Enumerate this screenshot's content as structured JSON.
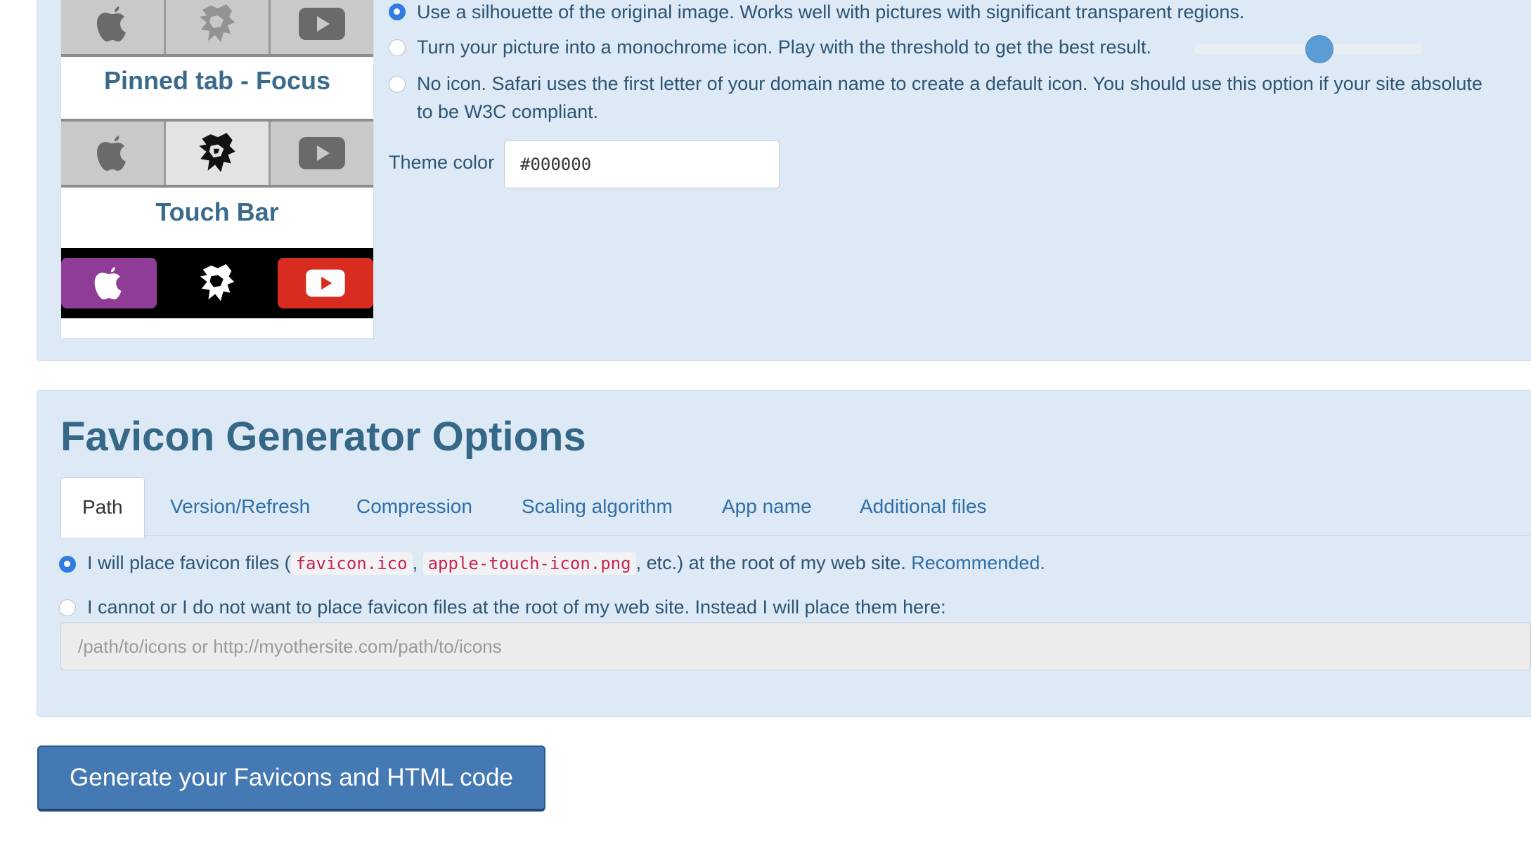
{
  "safari_options": {
    "radio_silhouette": "Use a silhouette of the original image. Works well with pictures with significant transparent regions.",
    "radio_monochrome": "Turn your picture into a monochrome icon. Play with the threshold to get the best result.",
    "radio_no_icon_line1": "No icon. Safari uses the first letter of your domain name to create a default icon. You should use this option if your site absolute",
    "radio_no_icon_line2": "to be W3C compliant.",
    "selected": "silhouette",
    "threshold_fraction": 0.55,
    "theme_color_label": "Theme color",
    "theme_color_value": "#000000"
  },
  "preview": {
    "pinned_focus_label": "Pinned tab - Focus",
    "touch_bar_label": "Touch Bar",
    "tab_icons": [
      "apple-icon",
      "lion-icon",
      "youtube-icon"
    ]
  },
  "generator_options": {
    "title": "Favicon Generator Options",
    "tabs": [
      {
        "label": "Path",
        "active": true
      },
      {
        "label": "Version/Refresh"
      },
      {
        "label": "Compression"
      },
      {
        "label": "Scaling algorithm"
      },
      {
        "label": "App name"
      },
      {
        "label": "Additional files"
      }
    ],
    "path_root_prefix": "I will place favicon files (",
    "path_root_file1": "favicon.ico",
    "path_root_sep": ",",
    "path_root_file2": "apple-touch-icon.png",
    "path_root_suffix": ", etc.) at the root of my web site.",
    "path_root_recommended": "Recommended.",
    "path_custom_label": "I cannot or I do not want to place favicon files at the root of my web site. Instead I will place them here:",
    "path_custom_placeholder": "/path/to/icons or http://myothersite.com/path/to/icons",
    "selected": "root"
  },
  "generate_button": "Generate your Favicons and HTML code",
  "colors": {
    "panel_bg": "#dde9f5",
    "accent": "#2f7de1",
    "button": "#4579b4",
    "touchbar_apple": "#8f3c97",
    "touchbar_youtube": "#d82c20"
  }
}
